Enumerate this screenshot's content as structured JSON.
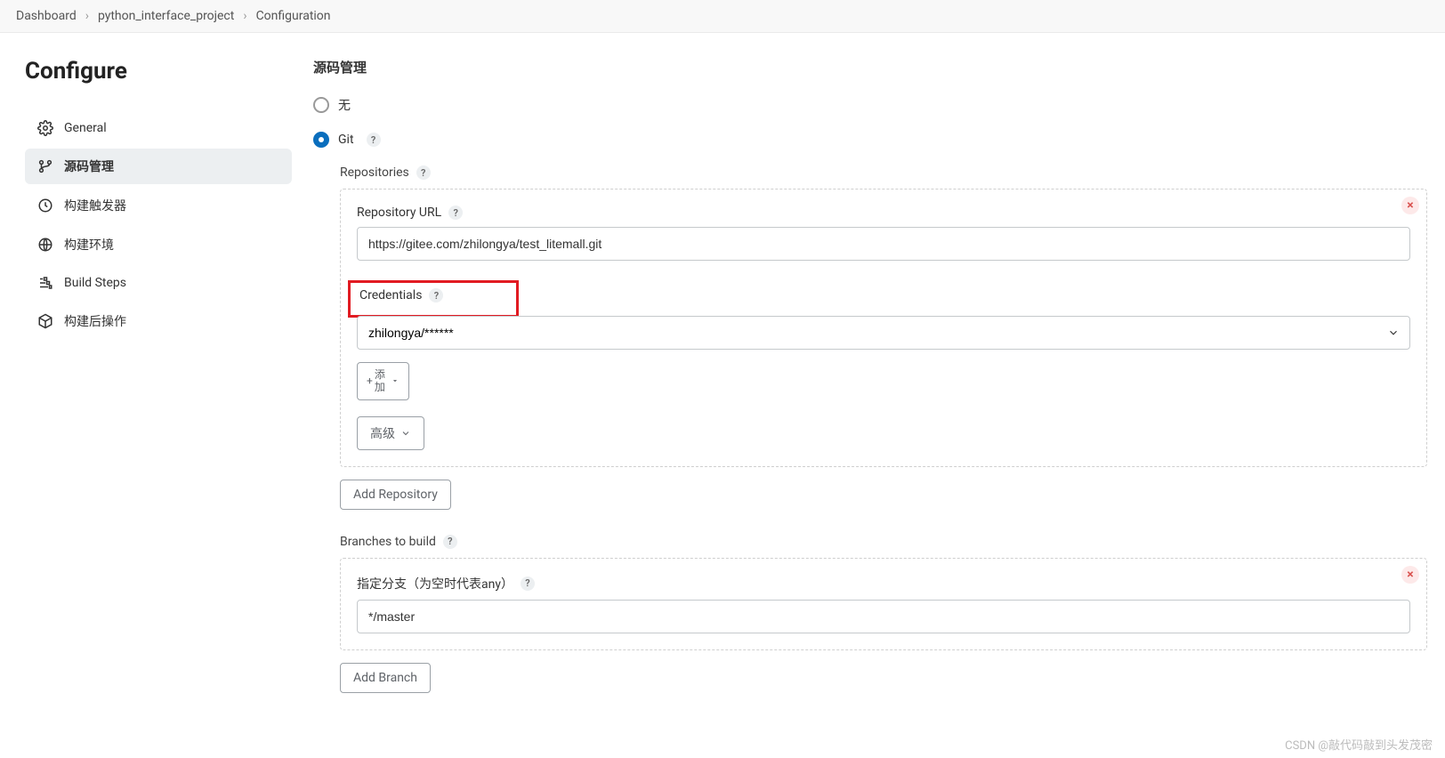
{
  "breadcrumb": {
    "items": [
      "Dashboard",
      "python_interface_project",
      "Configuration"
    ]
  },
  "page": {
    "title": "Configure"
  },
  "sidebar": {
    "items": [
      {
        "label": "General"
      },
      {
        "label": "源码管理"
      },
      {
        "label": "构建触发器"
      },
      {
        "label": "构建环境"
      },
      {
        "label": "Build Steps"
      },
      {
        "label": "构建后操作"
      }
    ]
  },
  "scm": {
    "title": "源码管理",
    "none_label": "无",
    "git_label": "Git",
    "repos_label": "Repositories",
    "repo_url_label": "Repository URL",
    "repo_url_value": "https://gitee.com/zhilongya/test_litemall.git",
    "credentials_label": "Credentials",
    "credentials_value": "zhilongya/******",
    "add_label_line1": "添",
    "add_label_line2": "加",
    "advanced_label": "高级",
    "add_repo_btn": "Add Repository",
    "branches_label": "Branches to build",
    "branch_spec_label": "指定分支（为空时代表any）",
    "branch_value": "*/master",
    "add_branch_btn": "Add Branch"
  },
  "help": "?",
  "watermark": "CSDN @敲代码敲到头发茂密"
}
